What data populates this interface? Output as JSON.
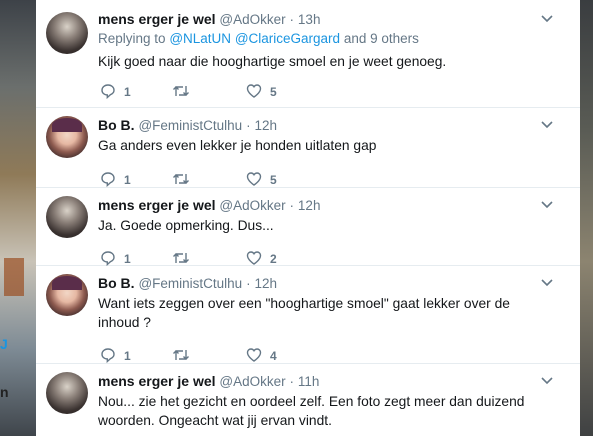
{
  "tweets": [
    {
      "author": {
        "name": "mens erger je wel",
        "handle": "@AdOkker"
      },
      "time": "13h",
      "replying": {
        "prefix": "Replying to",
        "mention1": "@NLatUN",
        "mention2": "@ClariceGargard",
        "suffix": "and 9 others"
      },
      "text": "Kijk goed naar die hooghartige smoel en je weet genoeg.",
      "replies": "1",
      "retweets": "",
      "likes": "5"
    },
    {
      "author": {
        "name": "Bo B.",
        "handle": "@FeministCtulhu"
      },
      "time": "12h",
      "text": "Ga anders even lekker je honden uitlaten gap",
      "replies": "1",
      "retweets": "",
      "likes": "5"
    },
    {
      "author": {
        "name": "mens erger je wel",
        "handle": "@AdOkker"
      },
      "time": "12h",
      "text": "Ja. Goede opmerking. Dus...",
      "replies": "1",
      "retweets": "",
      "likes": "2"
    },
    {
      "author": {
        "name": "Bo B.",
        "handle": "@FeministCtulhu"
      },
      "time": "12h",
      "text": "Want iets zeggen over een \"hooghartige smoel\" gaat lekker over de inhoud ?",
      "replies": "1",
      "retweets": "",
      "likes": "4"
    },
    {
      "author": {
        "name": "mens erger je wel",
        "handle": "@AdOkker"
      },
      "time": "11h",
      "text": "Nou... zie het gezicht en oordeel zelf. Een foto zegt meer dan duizend woorden. Ongeacht wat jij ervan vindt."
    }
  ],
  "separator": "·",
  "background_fragments": {
    "left_mid": "J",
    "left_bottom": "n"
  },
  "colors": {
    "link": "#1b95e0",
    "muted": "#657786",
    "text": "#14171a"
  }
}
